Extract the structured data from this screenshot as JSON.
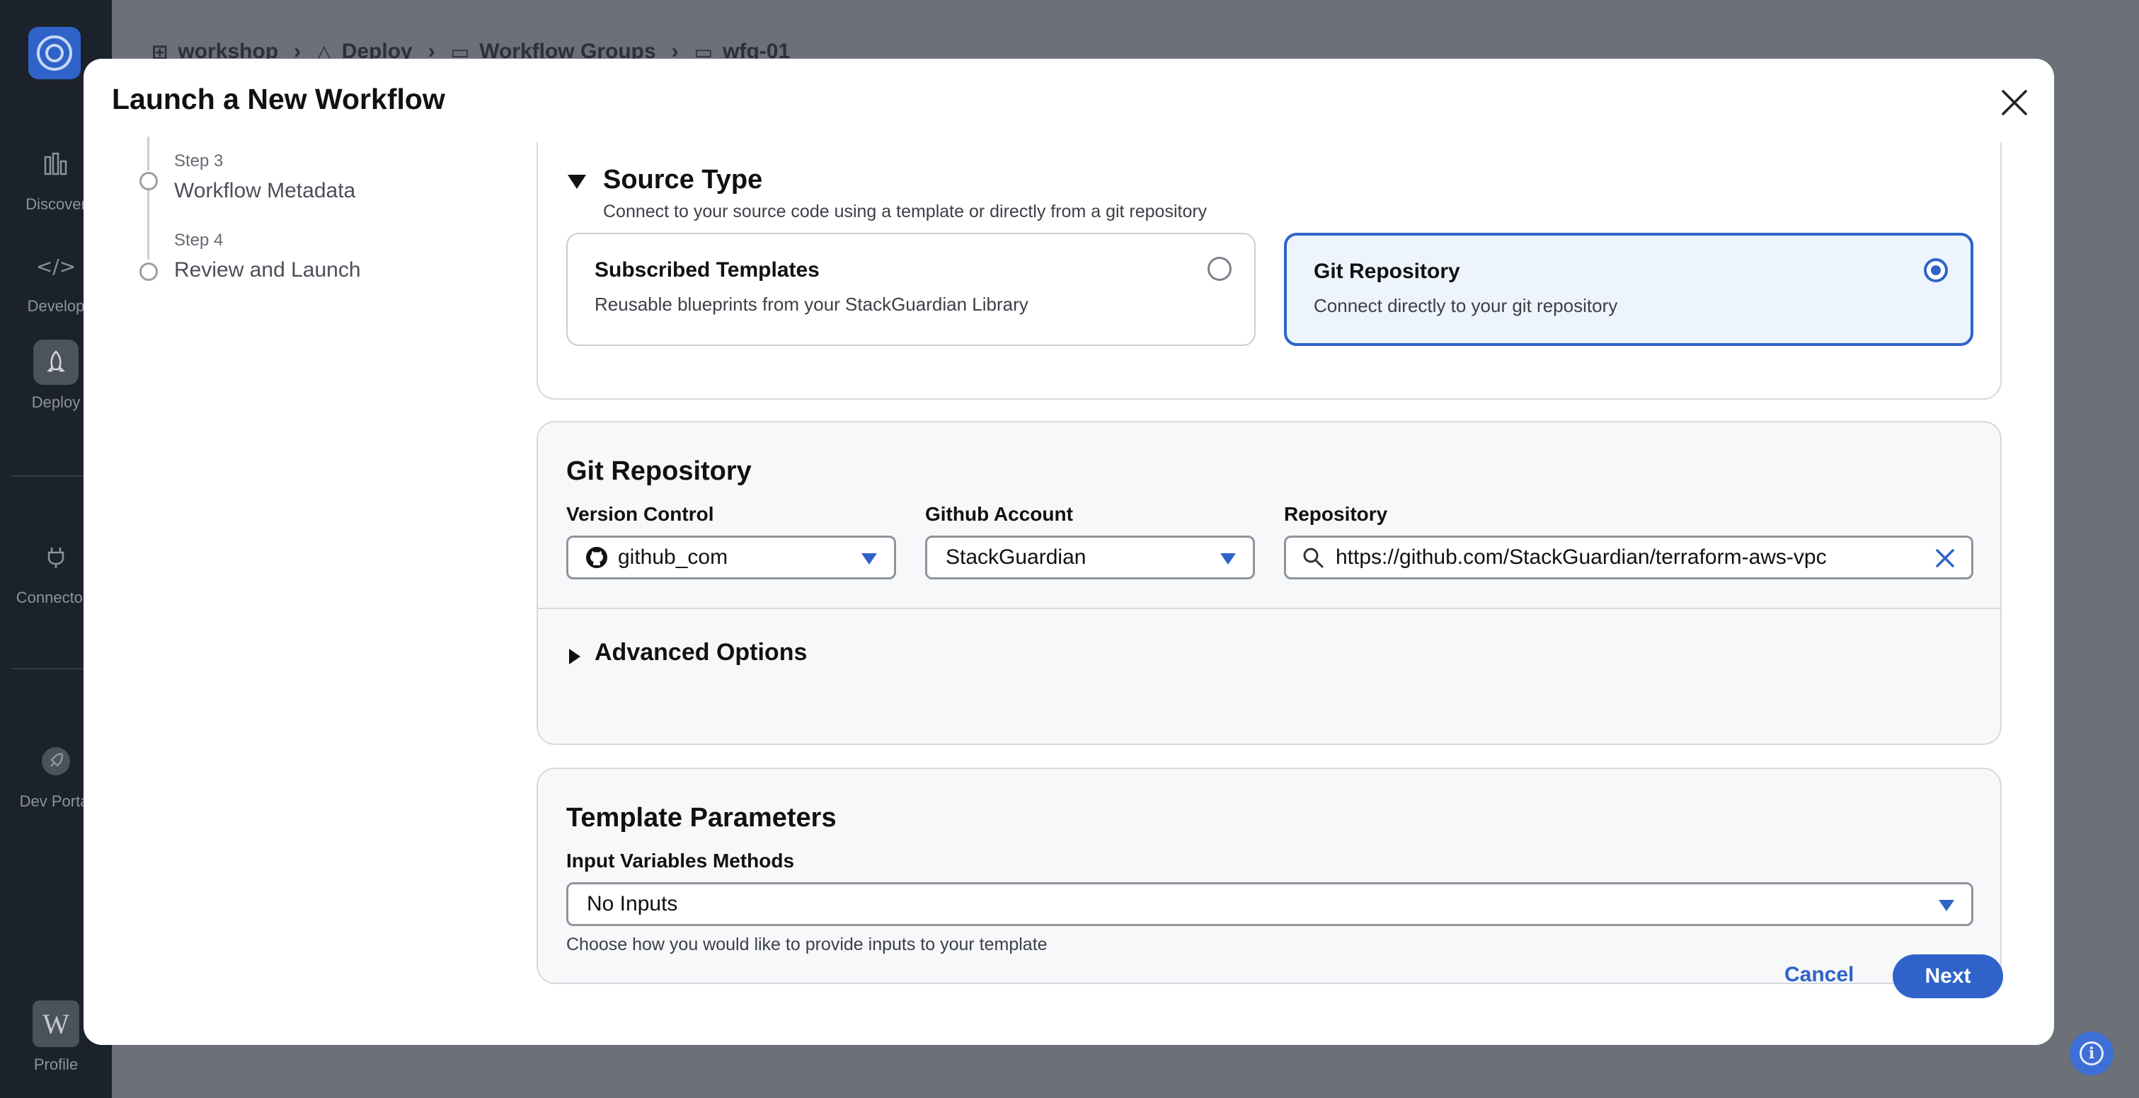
{
  "sidebar": {
    "items": [
      {
        "label": "Discover",
        "icon": "bar-chart-icon"
      },
      {
        "label": "Develop",
        "icon": "code-icon"
      },
      {
        "label": "Deploy",
        "icon": "deploy-rocket-icon"
      },
      {
        "label": "Connectors",
        "icon": "plug-icon"
      },
      {
        "label": "Dev Portal",
        "icon": "rocket-icon"
      }
    ],
    "profile": {
      "label": "Profile",
      "initial": "W"
    }
  },
  "breadcrumb": [
    "workshop",
    "Deploy",
    "Workflow Groups",
    "wfg-01"
  ],
  "modal": {
    "title": "Launch a New Workflow",
    "steps": [
      {
        "step": "Step 3",
        "name": "Workflow Metadata"
      },
      {
        "step": "Step 4",
        "name": "Review and Launch"
      }
    ],
    "source_type": {
      "title": "Source Type",
      "description": "Connect to your source code using a template or directly from a git repository",
      "options": [
        {
          "title": "Subscribed Templates",
          "description": "Reusable blueprints from your StackGuardian Library",
          "selected": false
        },
        {
          "title": "Git Repository",
          "description": "Connect directly to your git repository",
          "selected": true
        }
      ]
    },
    "git_repository": {
      "title": "Git Repository",
      "version_control_label": "Version Control",
      "version_control_value": "github_com",
      "github_account_label": "Github Account",
      "github_account_value": "StackGuardian",
      "repository_label": "Repository",
      "repository_value": "https://github.com/StackGuardian/terraform-aws-vpc",
      "advanced_options": "Advanced Options"
    },
    "template_parameters": {
      "title": "Template Parameters",
      "input_methods_label": "Input Variables Methods",
      "input_methods_value": "No Inputs",
      "helper": "Choose how you would like to provide inputs to your template"
    },
    "buttons": {
      "cancel": "Cancel",
      "next": "Next"
    }
  },
  "colors": {
    "accent": "#2f63c9",
    "sidebar": "#1c222b",
    "overlay": "#6b7079"
  }
}
